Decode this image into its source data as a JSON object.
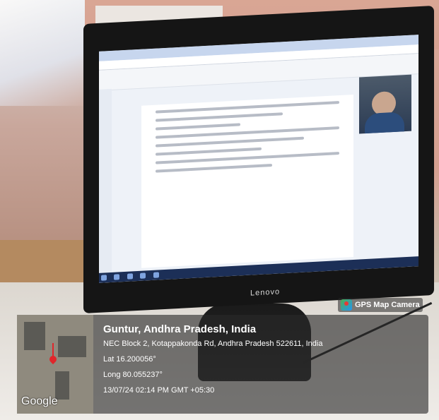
{
  "monitor": {
    "brand": "Lenovo"
  },
  "gps_badge": {
    "label": "GPS Map Camera"
  },
  "location": {
    "city": "Guntur, Andhra Pradesh, India",
    "address": "NEC Block 2, Kotappakonda Rd, Andhra Pradesh 522611, India",
    "latitude": "Lat 16.200056°",
    "longitude": "Long 80.055237°",
    "timestamp": "13/07/24 02:14 PM GMT +05:30"
  },
  "map": {
    "logo": "Google"
  },
  "icons": {
    "pin": "map-pin-icon",
    "gps": "gps-camera-icon"
  }
}
